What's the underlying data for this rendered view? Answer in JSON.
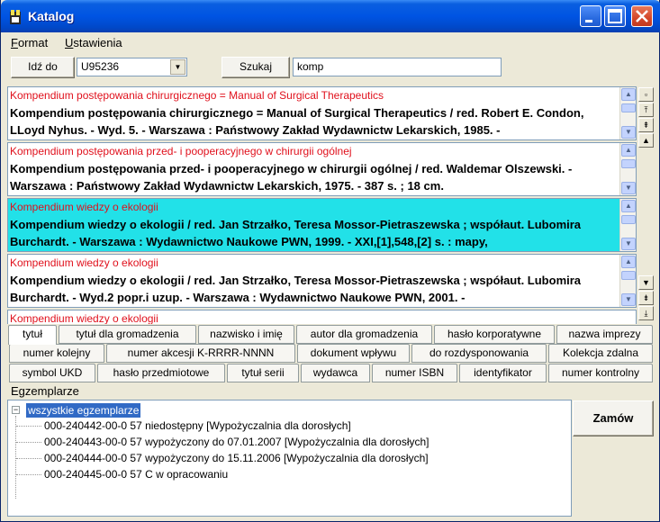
{
  "window": {
    "title": "Katalog"
  },
  "menu": [
    {
      "first": "F",
      "rest": "ormat"
    },
    {
      "first": "U",
      "rest": "stawienia"
    }
  ],
  "toolbar": {
    "goto_label": "Idź do",
    "combo_value": "U95236",
    "search_label": "Szukaj",
    "search_value": "komp"
  },
  "records": [
    {
      "title": "Kompendium postępowania chirurgicznego = Manual of Surgical Therapeutics",
      "desc": "Kompendium postępowania chirurgicznego = Manual of Surgical Therapeutics / red. Robert E. Condon, LLoyd Nyhus. - Wyd. 5. - Warszawa : Państwowy Zakład Wydawnictw Lekarskich, 1985. -"
    },
    {
      "title": "Kompendium postępowania przed- i pooperacyjnego w chirurgii ogólnej",
      "desc": "Kompendium postępowania przed- i pooperacyjnego w chirurgii ogólnej / red. Waldemar Olszewski. - Warszawa : Państwowy Zakład Wydawnictw Lekarskich, 1975. - 387 s. ; 18 cm."
    },
    {
      "title": "Kompendium wiedzy o ekologii",
      "desc": "Kompendium wiedzy o ekologii / red. Jan Strzałko, Teresa Mossor-Pietraszewska ; współaut. Lubomira Burchardt. - Warszawa : Wydawnictwo Naukowe PWN, 1999. - XXI,[1],548,[2] s. : mapy,"
    },
    {
      "title": "Kompendium wiedzy o ekologii",
      "desc": "Kompendium wiedzy o ekologii / red. Jan Strzałko, Teresa Mossor-Pietraszewska ; współaut. Lubomira Burchardt. - Wyd.2 popr.i uzup. - Warszawa : Wydawnictwo Naukowe PWN, 2001. -"
    },
    {
      "title": "Kompendium wiedzy o ekologii"
    }
  ],
  "tabs_row1": [
    "tytuł",
    "tytuł dla gromadzenia",
    "nazwisko i imię",
    "autor dla gromadzenia",
    "hasło korporatywne",
    "nazwa imprezy"
  ],
  "tabs_row2": [
    "numer kolejny",
    "numer akcesji K-RRRR-NNNN",
    "dokument wpływu",
    "do rozdysponowania",
    "Kolekcja zdalna"
  ],
  "tabs_row3": [
    "symbol UKD",
    "hasło przedmiotowe",
    "tytuł serii",
    "wydawca",
    "numer ISBN",
    "identyfikator",
    "numer kontrolny"
  ],
  "copies": {
    "label": "Egzemplarze",
    "root": "wszystkie egzemplarze",
    "items": [
      "000-240442-00-0 57 niedostępny [Wypożyczalnia dla dorosłych]",
      "000-240443-00-0 57 wypożyczony do 07.01.2007 [Wypożyczalnia dla dorosłych]",
      "000-240444-00-0 57 wypożyczony do 15.11.2006 [Wypożyczalnia dla dorosłych]",
      "000-240445-00-0 57 C w opracowaniu"
    ]
  },
  "order_button": "Zamów"
}
